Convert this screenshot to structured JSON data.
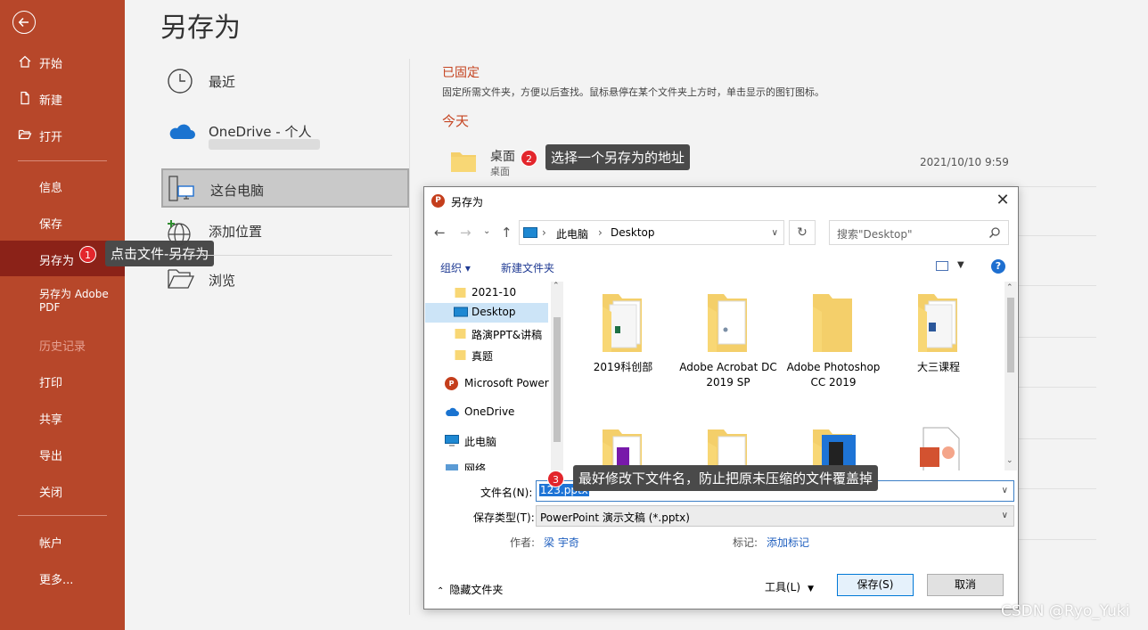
{
  "sidebar": {
    "back_icon": "arrow-left-icon",
    "items": [
      {
        "label": "开始",
        "icon": "home-icon"
      },
      {
        "label": "新建",
        "icon": "new-doc-icon"
      },
      {
        "label": "打开",
        "icon": "open-folder-icon"
      },
      {
        "label": "信息"
      },
      {
        "label": "保存"
      },
      {
        "label": "另存为"
      },
      {
        "label": "另存为 Adobe PDF"
      },
      {
        "label": "历史记录"
      },
      {
        "label": "打印"
      },
      {
        "label": "共享"
      },
      {
        "label": "导出"
      },
      {
        "label": "关闭"
      },
      {
        "label": "帐户"
      },
      {
        "label": "更多..."
      }
    ]
  },
  "main": {
    "title": "另存为",
    "locations": [
      {
        "label": "最近",
        "icon": "clock-icon"
      },
      {
        "label": "OneDrive - 个人",
        "icon": "cloud-icon"
      },
      {
        "label": "这台电脑",
        "icon": "computer-icon"
      },
      {
        "label": "添加位置",
        "icon": "globe-add-icon"
      },
      {
        "label": "浏览",
        "icon": "open-folder-icon"
      }
    ],
    "pinned_title": "已固定",
    "pinned_desc": "固定所需文件夹，方便以后查找。鼠标悬停在某个文件夹上方时，单击显示的图钉图标。",
    "today_title": "今天",
    "recent_folder": {
      "name": "桌面",
      "path": "桌面",
      "date": "2021/10/10 9:59"
    }
  },
  "callouts": [
    {
      "num": "1",
      "text": "点击文件-另存为"
    },
    {
      "num": "2",
      "text": "选择一个另存为的地址"
    },
    {
      "num": "3",
      "text": "最好修改下文件名，防止把原未压缩的文件覆盖掉"
    }
  ],
  "dialog": {
    "title": "另存为",
    "app_icon_letter": "P",
    "breadcrumb": [
      "此电脑",
      "Desktop"
    ],
    "search_placeholder": "搜索\"Desktop\"",
    "toolbar": {
      "organize": "组织 ▾",
      "new_folder": "新建文件夹",
      "help": "?"
    },
    "nav_items": [
      {
        "label": "2021-10",
        "icon": "folder-icon"
      },
      {
        "label": "Desktop",
        "icon": "desktop-icon"
      },
      {
        "label": "路演PPT&讲稿",
        "icon": "folder-icon"
      },
      {
        "label": "真题",
        "icon": "folder-icon"
      },
      {
        "label": "Microsoft Power",
        "icon": "powerpoint-icon"
      },
      {
        "label": "OneDrive",
        "icon": "cloud-icon"
      },
      {
        "label": "此电脑",
        "icon": "computer-icon"
      },
      {
        "label": "网络",
        "icon": "network-icon"
      }
    ],
    "files": [
      {
        "name": "2019科创部"
      },
      {
        "name": "Adobe Acrobat DC 2019 SP"
      },
      {
        "name": "Adobe Photoshop CC 2019"
      },
      {
        "name": "大三课程"
      }
    ],
    "filename_label": "文件名(N):",
    "filename_value": "123.pptx",
    "filetype_label": "保存类型(T):",
    "filetype_value": "PowerPoint 演示文稿 (*.pptx)",
    "author_label": "作者:",
    "author_value": "梁 宇奇",
    "tags_label": "标记:",
    "tags_value": "添加标记",
    "hide_folders": "隐藏文件夹",
    "tools_label": "工具(L)",
    "save_label": "保存(S)",
    "cancel_label": "取消"
  },
  "watermark": "CSDN @Ryo_Yuki",
  "colors": {
    "sidebar": "#b7472a",
    "sidebar_active": "#8b2218",
    "accent": "#c54421",
    "badge": "#e3262c"
  }
}
